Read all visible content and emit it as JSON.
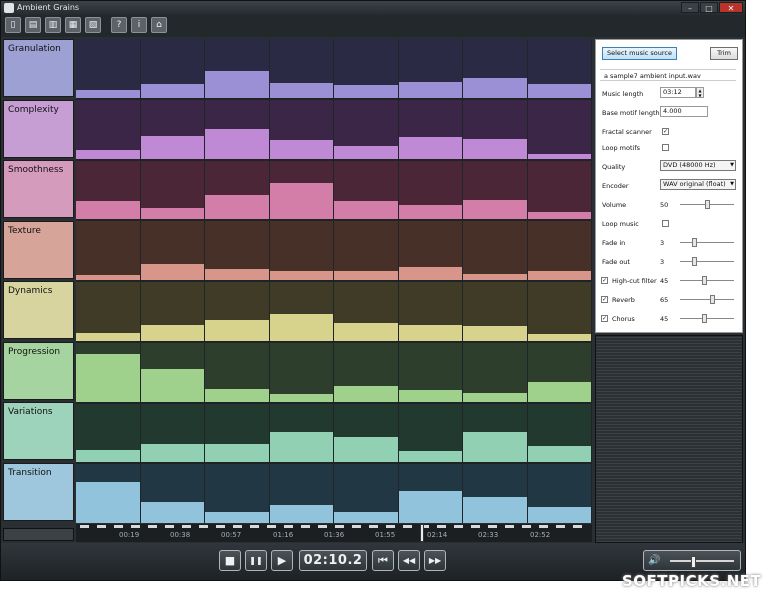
{
  "window": {
    "title": "Ambient Grains",
    "controls": [
      "–",
      "□",
      "✕"
    ]
  },
  "toolbar": {
    "buttons": [
      {
        "name": "new-icon",
        "glyph": "▯"
      },
      {
        "name": "open-icon",
        "glyph": "▤"
      },
      {
        "name": "save-icon",
        "glyph": "▥"
      },
      {
        "name": "save-as-icon",
        "glyph": "▦"
      },
      {
        "name": "export-icon",
        "glyph": "▧"
      },
      {
        "name": "help-icon",
        "glyph": "?"
      },
      {
        "name": "info-icon",
        "glyph": "i"
      },
      {
        "name": "home-icon",
        "glyph": "⌂"
      }
    ]
  },
  "params": [
    {
      "label": "Granulation",
      "label_color": "#9da0d2",
      "bg": "#2a2a45",
      "fill": "#9b8fd6",
      "levels": [
        0.14,
        0.24,
        0.46,
        0.25,
        0.22,
        0.26,
        0.33,
        0.24
      ]
    },
    {
      "label": "Complexity",
      "label_color": "#c79ed4",
      "bg": "#3b2648",
      "fill": "#c089d6",
      "levels": [
        0.15,
        0.39,
        0.51,
        0.31,
        0.22,
        0.36,
        0.33,
        0.07
      ]
    },
    {
      "label": "Smoothness",
      "label_color": "#d59bbd",
      "bg": "#4a2637",
      "fill": "#d27ea9",
      "levels": [
        0.31,
        0.19,
        0.41,
        0.62,
        0.31,
        0.25,
        0.33,
        0.12
      ]
    },
    {
      "label": "Texture",
      "label_color": "#d6a498",
      "bg": "#463027",
      "fill": "#d8958a",
      "levels": [
        0.09,
        0.27,
        0.19,
        0.16,
        0.15,
        0.23,
        0.11,
        0.15
      ]
    },
    {
      "label": "Dynamics",
      "label_color": "#d7d49f",
      "bg": "#3f3b27",
      "fill": "#d7d28c",
      "levels": [
        0.14,
        0.27,
        0.36,
        0.45,
        0.31,
        0.27,
        0.25,
        0.12
      ]
    },
    {
      "label": "Progression",
      "label_color": "#a6d4a0",
      "bg": "#2d3f2c",
      "fill": "#9fd18d",
      "levels": [
        0.81,
        0.56,
        0.21,
        0.12,
        0.27,
        0.19,
        0.15,
        0.34
      ]
    },
    {
      "label": "Variations",
      "label_color": "#9ed3bb",
      "bg": "#21392e",
      "fill": "#92d0b4",
      "levels": [
        0.21,
        0.31,
        0.31,
        0.52,
        0.43,
        0.19,
        0.52,
        0.28
      ]
    },
    {
      "label": "Transition",
      "label_color": "#9ec7dd",
      "bg": "#223744",
      "fill": "#92c3dd",
      "levels": [
        0.7,
        0.36,
        0.18,
        0.31,
        0.18,
        0.54,
        0.45,
        0.28
      ]
    }
  ],
  "timeline": {
    "ticks": [
      "00:19",
      "00:38",
      "00:57",
      "01:16",
      "01:36",
      "01:55",
      "02:14",
      "02:33",
      "02:52"
    ],
    "position": 0.67
  },
  "panel": {
    "select_source": "Select music source",
    "trim": "Trim",
    "file": "a sample7 ambient input.wav",
    "music_length_label": "Music length",
    "music_length": "03:12",
    "base_motif_label": "Base motif length",
    "base_motif": "4.000",
    "fractal_label": "Fractal scanner",
    "fractal_checked": true,
    "loop_motifs_label": "Loop motifs",
    "loop_motifs_checked": false,
    "quality_label": "Quality",
    "quality_value": "DVD    (48000 Hz)",
    "encoder_label": "Encoder",
    "encoder_value": "WAV original (float)",
    "volume_label": "Volume",
    "volume": "50",
    "volume_level": 0.5,
    "loop_music_label": "Loop music",
    "loop_music_checked": false,
    "fade_in_label": "Fade in",
    "fade_in": "3",
    "fade_in_level": 0.25,
    "fade_out_label": "Fade out",
    "fade_out": "3",
    "fade_out_level": 0.25,
    "highcut_label": "High-cut filter",
    "highcut": "45",
    "highcut_checked": true,
    "highcut_level": 0.45,
    "reverb_label": "Reverb",
    "reverb": "65",
    "reverb_checked": true,
    "reverb_level": 0.62,
    "chorus_label": "Chorus",
    "chorus": "45",
    "chorus_checked": true,
    "chorus_level": 0.45,
    "check_mark": "✓"
  },
  "transport": {
    "stop": "■",
    "pause": "❚❚",
    "play": "▶",
    "time": "02:10.2",
    "prev": "⏮",
    "rewind": "◀◀",
    "forward": "▶▶",
    "speaker": "🔊",
    "volume_level": 0.34
  },
  "watermark": "SOFTPICKS.NET"
}
